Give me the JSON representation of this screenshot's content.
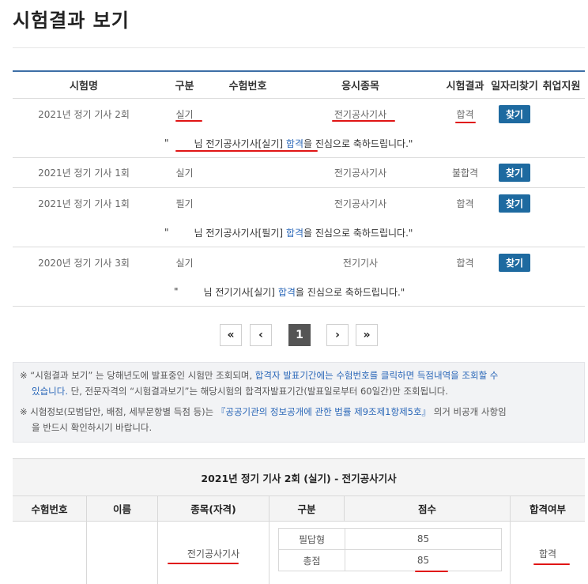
{
  "page_title": "시험결과 보기",
  "table": {
    "headers": [
      "시험명",
      "구분",
      "수험번호",
      "응시종목",
      "시험결과",
      "일자리찾기",
      "취업지원"
    ],
    "find_label": "찾기",
    "rows": [
      {
        "name": "2021년 정기 기사 2회",
        "type": "실기",
        "subject": "전기공사기사",
        "result": "합격",
        "message": {
          "open_quote": "\"",
          "suffix": "님 전기공사기사[실기]",
          "pass": "합격",
          "rest": "을 진심으로 축하드립니다.\""
        }
      },
      {
        "name": "2021년 정기 기사 1회",
        "type": "실기",
        "subject": "전기공사기사",
        "result": "불합격"
      },
      {
        "name": "2021년 정기 기사 1회",
        "type": "필기",
        "subject": "전기공사기사",
        "result": "합격",
        "message": {
          "open_quote": "\"",
          "suffix": "님 전기공사기사[필기]",
          "pass": "합격",
          "rest": "을 진심으로 축하드립니다.\""
        }
      },
      {
        "name": "2020년 정기 기사 3회",
        "type": "실기",
        "subject": "전기기사",
        "result": "합격",
        "message": {
          "open_quote": "\"",
          "suffix": "님 전기기사[실기]",
          "pass": "합격",
          "rest": "을 진심으로 축하드립니다.\""
        }
      }
    ]
  },
  "pagination": {
    "first": "«",
    "prev": "‹",
    "current": "1",
    "next": "›",
    "last": "»"
  },
  "notice": {
    "line1a": "※ “시험결과 보기” 는 당해년도에 발표중인 시험만 조회되며, ",
    "line1b": "합격자 발표기간에는 수험번호를 클릭하면 득점내역을 조회할 수",
    "line2a": "있습니다.",
    "line2b": " 단, 전문자격의 “시험결과보기”는 해당시험의 합격자발표기간(발표일로부터 60일간)만 조회됩니다.",
    "line3a": "※ 시험정보(모범답안, 배점, 세부문항별 득점 등)는 ",
    "line3b": "『공공기관의 정보공개에 관한 법률 제9조제1항제5호』",
    "line3c": " 의거 비공개 사항임",
    "line4": "을 반드시 확인하시기 바랍니다."
  },
  "detail": {
    "title": "2021년 정기 기사 2회 (실기) - 전기공사기사",
    "headers": [
      "수험번호",
      "이름",
      "종목(자격)",
      "구분",
      "점수",
      "합격여부"
    ],
    "subject": "전기공사기사",
    "scores": [
      {
        "label": "필답형",
        "value": "85"
      },
      {
        "label": "총점",
        "value": "85"
      }
    ],
    "pass": "합격"
  }
}
